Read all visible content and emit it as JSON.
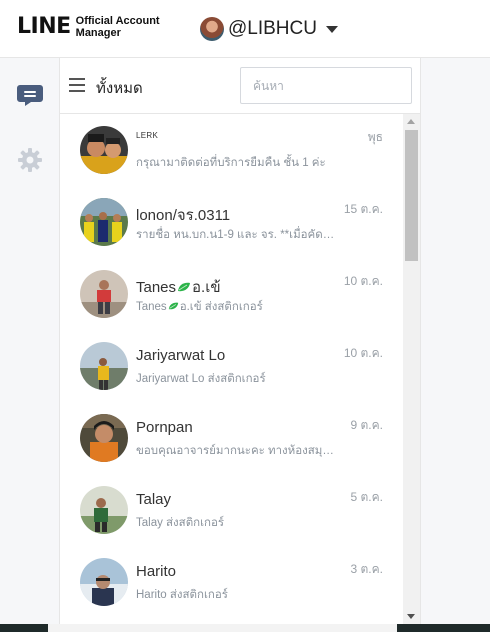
{
  "header": {
    "logo_main": "LINE",
    "logo_sub_1": "Official Account",
    "logo_sub_2": "Manager",
    "account_name": "@LIBHCU"
  },
  "rail": {
    "items": [
      {
        "icon": "chat-icon",
        "active": true
      },
      {
        "icon": "gear-icon",
        "active": false
      }
    ]
  },
  "toolbar": {
    "filter_label": "ทั้งหมด",
    "search_placeholder": "ค้นหา",
    "search_value": ""
  },
  "chats": [
    {
      "name": "LERK",
      "time": "พุธ",
      "preview_before": "กรุณามาติดต่อที่บริการยืมคืน ชั้น 1 ค่ะ",
      "preview_after": ""
    },
    {
      "name": "lonon/จร.0311",
      "time": "15 ต.ค.",
      "preview_before": "รายชื่อ หน.บก.น1-9 และ จร. **เมื่อคัดเลือก",
      "preview_after": ""
    },
    {
      "name_before": "Tanes",
      "name_after": "อ.เข้",
      "time": "10 ต.ค.",
      "preview_before": "Tanes",
      "preview_after": "อ.เข้ ส่งสติกเกอร์",
      "has_leaf": true
    },
    {
      "name": "Jariyarwat Lo",
      "time": "10 ต.ค.",
      "preview_before": "Jariyarwat Lo ส่งสติกเกอร์",
      "preview_after": ""
    },
    {
      "name": "Pornpan",
      "time": "9 ต.ค.",
      "preview_before": "ขอบคุณอาจารย์มากนะคะ ทางห้องสมุดได้รับเรียบร้อยแล้ว",
      "preview_after": ""
    },
    {
      "name": "Talay",
      "time": "5 ต.ค.",
      "preview_before": "Talay ส่งสติกเกอร์",
      "preview_after": ""
    },
    {
      "name": "Harito",
      "time": "3 ต.ค.",
      "preview_before": "Harito ส่งสติกเกอร์",
      "preview_after": ""
    }
  ],
  "colors": {
    "brand_green": "#06c755",
    "rail_active": "#4a5d7e",
    "rail_inactive": "#c9ced6",
    "leaf_green": "#2cb34a"
  }
}
